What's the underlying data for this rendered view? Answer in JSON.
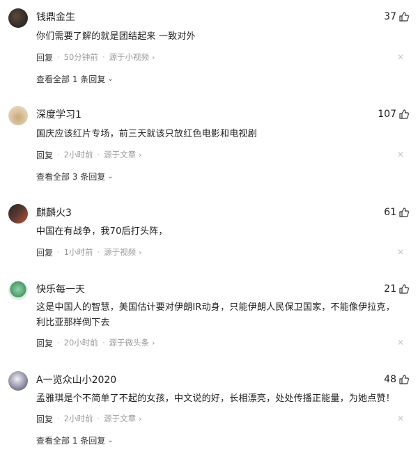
{
  "comments": [
    {
      "user": "钱鼎金生",
      "likes": "37",
      "text": "你们需要了解的就是团结起来 一致对外",
      "reply_label": "回复",
      "time": "50分钟前",
      "source": "源于小视频",
      "view_replies": "查看全部 1 条回复",
      "avatar_colors": [
        "#2a2a2a",
        "#5a4a3a"
      ]
    },
    {
      "user": "深度学习1",
      "likes": "107",
      "text": "国庆应该红片专场，前三天就该只放红色电影和电视剧",
      "reply_label": "回复",
      "time": "2小时前",
      "source": "源于文章",
      "view_replies": "查看全部 3 条回复",
      "avatar_colors": [
        "#e8dfc8",
        "#c9a878"
      ]
    },
    {
      "user": "麒麟火3",
      "likes": "61",
      "text": "中国在有战争，我70后打头阵，",
      "reply_label": "回复",
      "time": "1小时前",
      "source": "源于视频",
      "view_replies": "",
      "avatar_colors": [
        "#3a3030",
        "#b84a3a"
      ]
    },
    {
      "user": "快乐每一天",
      "likes": "21",
      "text_line1": "这是中国人的智慧，美国估计要对伊朗IR动身，只能伊朗人民保卫国家，不能像伊拉克，",
      "text_line2": "利比亚那样倒下去",
      "reply_label": "回复",
      "time": "20小时前",
      "source": "源于微头条",
      "view_replies": "",
      "avatar_colors": [
        "#bfe3cf",
        "#4a8a5a"
      ]
    },
    {
      "user": "A一览众山小2020",
      "likes": "48",
      "text": "孟雅琪是个不简单了不起的女孩，中文说的好，长相漂亮，处处传播正能量，为她点赞！",
      "reply_label": "回复",
      "time": "2小时前",
      "source": "源于文章",
      "view_replies": "查看全部 1 条回复",
      "avatar_colors": [
        "#d8d8e0",
        "#5a5a70"
      ]
    }
  ],
  "icons": {
    "like": "thumbs-up-icon",
    "close": "close-icon",
    "chevron_right": "chevron-right-icon",
    "chevron_down": "chevron-down-icon"
  }
}
